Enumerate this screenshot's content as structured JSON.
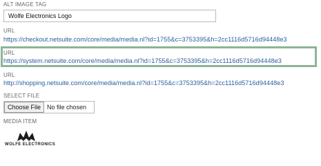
{
  "alt_image_tag": {
    "label": "ALT IMAGE TAG",
    "value": "Wolfe Electronics Logo"
  },
  "urls": [
    {
      "label": "URL",
      "href": "https://checkout.netsuite.com/core/media/media.nl?id=1755&c=3753395&h=2cc1116d5716d94448e3"
    },
    {
      "label": "URL",
      "href": "https://system.netsuite.com/core/media/media.nl?id=1755&c=3753395&h=2cc1116d5716d94448e3"
    },
    {
      "label": "URL",
      "href": "http://shopping.netsuite.com/core/media/media.nl?id=1755&c=3753395&h=2cc1116d5716d94448e3"
    }
  ],
  "select_file": {
    "label": "SELECT FILE",
    "button_label": "Choose File",
    "status": "No file chosen"
  },
  "media_item": {
    "label": "MEDIA ITEM",
    "logo_text": "WOLFE ELECTRONICS",
    "logo_icon": "wolf-head-logo"
  },
  "colors": {
    "link": "#2a5f9e",
    "highlight": "#8db495"
  }
}
